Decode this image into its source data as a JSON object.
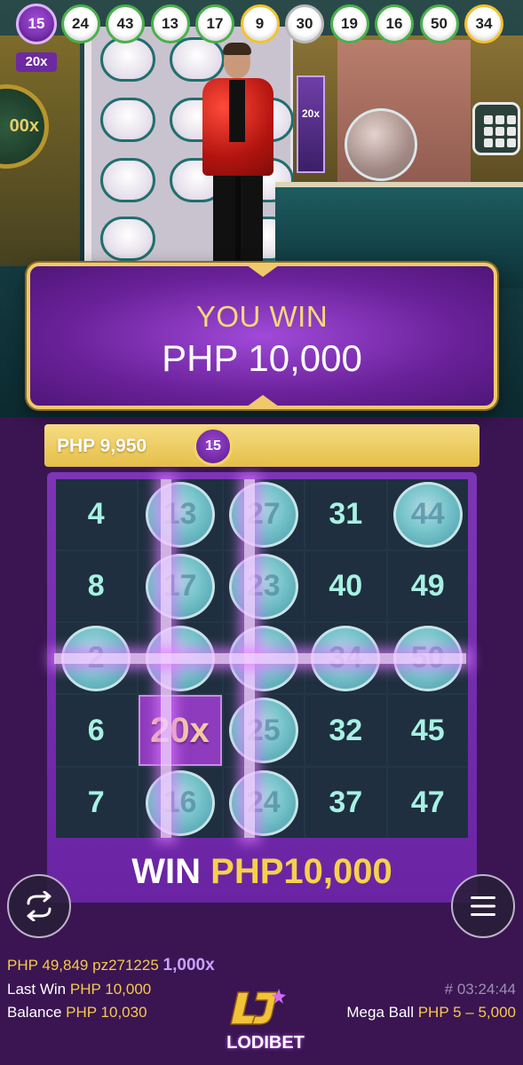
{
  "drawn_balls": [
    {
      "number": "15",
      "style": "mega"
    },
    {
      "number": "24",
      "style": "green"
    },
    {
      "number": "43",
      "style": "green"
    },
    {
      "number": "13",
      "style": "green"
    },
    {
      "number": "17",
      "style": "green"
    },
    {
      "number": "9",
      "style": "yellow"
    },
    {
      "number": "30",
      "style": "grey"
    },
    {
      "number": "19",
      "style": "green"
    },
    {
      "number": "16",
      "style": "green"
    },
    {
      "number": "50",
      "style": "green"
    },
    {
      "number": "34",
      "style": "yellow"
    }
  ],
  "mega_ball_multiplier": "20x",
  "studio": {
    "left_medal_text": "00x",
    "mega_sign_text": "20x"
  },
  "win_banner": {
    "line1": "YOU WIN",
    "line2": "PHP 10,000"
  },
  "payout_bar": {
    "amount": "PHP 9,950",
    "ball_number": "15"
  },
  "card": {
    "cells": [
      [
        "4",
        "13",
        "27",
        "31",
        "44"
      ],
      [
        "8",
        "17",
        "23",
        "40",
        "49"
      ],
      [
        "2",
        "",
        "",
        "34",
        "50"
      ],
      [
        "6",
        "20x",
        "25",
        "32",
        "45"
      ],
      [
        "7",
        "16",
        "24",
        "37",
        "47"
      ]
    ],
    "marked": [
      [
        false,
        true,
        true,
        false,
        true
      ],
      [
        false,
        true,
        true,
        false,
        false
      ],
      [
        true,
        true,
        true,
        true,
        true
      ],
      [
        false,
        false,
        true,
        false,
        false
      ],
      [
        false,
        true,
        true,
        false,
        false
      ]
    ],
    "mega_cell": {
      "row": 3,
      "col": 1
    }
  },
  "win_total": {
    "label": "WIN",
    "value": "PHP10,000"
  },
  "footer": {
    "jackpot": "PHP 49,849",
    "promo_code": "pz271225",
    "max_multiplier": "1,000x",
    "last_win_label": "Last Win",
    "last_win_value": "PHP 10,000",
    "balance_label": "Balance",
    "balance_value": "PHP 10,030",
    "round_id": "# 03:24:44",
    "mega_ball_label": "Mega Ball",
    "mega_ball_limits": "PHP 5 – 5,000"
  },
  "logo_text": "LODIBET",
  "colors": {
    "accent_gold": "#f6d04d",
    "accent_purple": "#c9a2ff",
    "cell_text": "#a7f1e3",
    "background": "#3a1552"
  },
  "icons": [
    "card-view-icon",
    "autoplay-repeat-icon",
    "menu-icon"
  ]
}
